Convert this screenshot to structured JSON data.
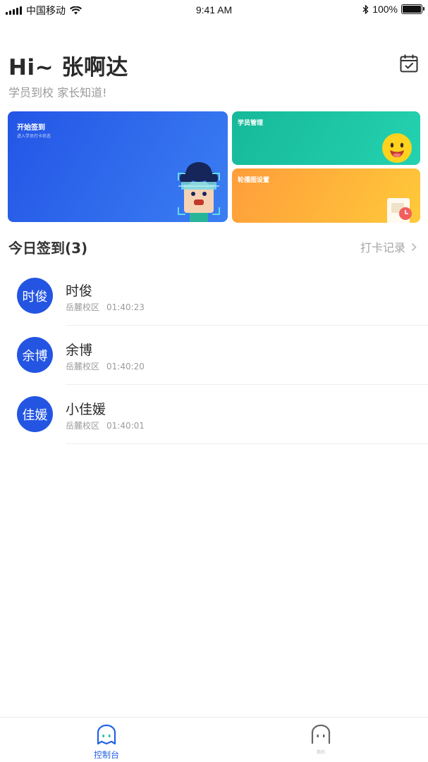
{
  "status_bar": {
    "carrier": "中国移动",
    "time": "9:41 AM",
    "battery": "100%"
  },
  "header": {
    "greeting": "Hi~ 张啊达",
    "subtitle": "学员到校 家长知道!",
    "calendar_icon": "calendar-check-icon"
  },
  "cards": {
    "checkin": {
      "title": "开始签到",
      "desc": "进入学员打卡状态"
    },
    "students": {
      "title": "学员管理"
    },
    "carousel": {
      "title": "轮播图设置"
    }
  },
  "today": {
    "title": "今日签到(3)",
    "records_link": "打卡记录"
  },
  "checkins": [
    {
      "avatar": "时俊",
      "name": "时俊",
      "campus": "岳麓校区",
      "time": "01:40:23"
    },
    {
      "avatar": "余博",
      "name": "余博",
      "campus": "岳麓校区",
      "time": "01:40:20"
    },
    {
      "avatar": "佳媛",
      "name": "小佳媛",
      "campus": "岳麓校区",
      "time": "01:40:01"
    }
  ],
  "tabbar": {
    "console_label": "控制台",
    "mine_label": "我的"
  },
  "colors": {
    "accent": "#2462e6",
    "avatar": "#2355e2",
    "green": "#1ec4a4",
    "orange": "#ffb13a"
  }
}
